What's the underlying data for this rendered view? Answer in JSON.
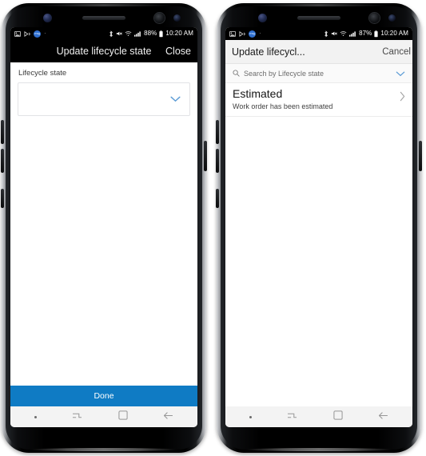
{
  "page": {
    "description": "Two Samsung Galaxy phone mockups showing an Update lifecycle state screen and its lookup list"
  },
  "colors": {
    "accent_blue": "#0f7bc4",
    "chevron_blue": "#5b9bd5",
    "status_bar_bg": "#000000",
    "dark_appbar_bg": "#000000",
    "light_appbar_bg": "#f2f2f2",
    "nav_bar_bg": "#f3f3f3",
    "screen_bg": "#ffffff"
  },
  "phone_left": {
    "status_bar": {
      "icons": [
        "image-icon",
        "play-icon",
        "messaging-badge-icon",
        "more-dot-icon"
      ],
      "badge_text": "msg",
      "right_icons": [
        "bluetooth-icon",
        "mute-icon",
        "wifi-icon",
        "signal-icon"
      ],
      "battery_percent": "88%",
      "battery_icon": "battery-icon",
      "clock": "10:20 AM"
    },
    "app_bar": {
      "title": "Update lifecycle state",
      "close_label": "Close"
    },
    "form": {
      "field_label": "Lifecycle state",
      "select_value": "",
      "select_placeholder": "",
      "chevron_icon": "chevron-down-icon"
    },
    "footer": {
      "done_label": "Done"
    },
    "nav_bar": {
      "items": [
        "menu-dot-icon",
        "recents-icon",
        "home-icon",
        "back-icon"
      ]
    }
  },
  "phone_right": {
    "status_bar": {
      "icons": [
        "image-icon",
        "play-icon",
        "messaging-badge-icon",
        "more-dot-icon"
      ],
      "badge_text": "msg",
      "right_icons": [
        "bluetooth-icon",
        "mute-icon",
        "wifi-icon",
        "signal-icon"
      ],
      "battery_percent": "87%",
      "battery_icon": "battery-icon",
      "clock": "10:20 AM"
    },
    "app_bar": {
      "title": "Update lifecycl...",
      "cancel_label": "Cancel"
    },
    "search": {
      "icon": "search-icon",
      "placeholder": "Search by Lifecycle state",
      "value": "",
      "chevron_icon": "chevron-down-icon"
    },
    "list": {
      "items": [
        {
          "title": "Estimated",
          "subtitle": "Work order has been estimated",
          "chevron_icon": "chevron-right-icon"
        }
      ]
    },
    "nav_bar": {
      "items": [
        "menu-dot-icon",
        "recents-icon",
        "home-icon",
        "back-icon"
      ]
    }
  }
}
